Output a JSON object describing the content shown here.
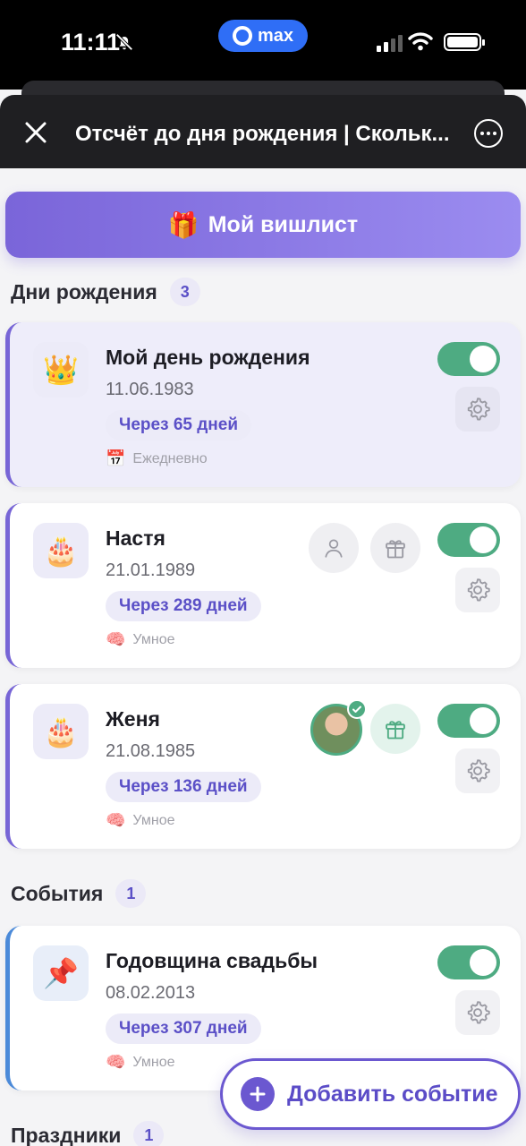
{
  "status_bar": {
    "time": "11:11",
    "app_badge": "max"
  },
  "header": {
    "title": "Отсчёт до дня рождения | Скольк..."
  },
  "wishlist_button": {
    "emoji": "🎁",
    "label": "Мой вишлист"
  },
  "sections": {
    "birthdays": {
      "title": "Дни рождения",
      "count": "3"
    },
    "events": {
      "title": "События",
      "count": "1"
    },
    "holidays": {
      "title": "Праздники",
      "count": "1"
    }
  },
  "cards": [
    {
      "emoji": "👑",
      "name": "Мой день рождения",
      "date": "11.06.1983",
      "countdown": "Через 65 дней",
      "mode_emoji": "📅",
      "mode": "Ежедневно",
      "enabled": true
    },
    {
      "emoji": "🎂",
      "name": "Настя",
      "date": "21.01.1989",
      "countdown": "Через 289 дней",
      "mode_emoji": "🧠",
      "mode": "Умное",
      "enabled": true
    },
    {
      "emoji": "🎂",
      "name": "Женя",
      "date": "21.08.1985",
      "countdown": "Через 136 дней",
      "mode_emoji": "🧠",
      "mode": "Умное",
      "enabled": true
    },
    {
      "emoji": "📌",
      "name": "Годовщина свадьбы",
      "date": "08.02.2013",
      "countdown": "Через 307 дней",
      "mode_emoji": "🧠",
      "mode": "Умное",
      "enabled": true
    }
  ],
  "add_event_button": {
    "label": "Добавить событие"
  },
  "colors": {
    "accent": "#6b58d0",
    "toggle_on": "#4eab82",
    "event_stripe": "#4b8ad9"
  }
}
